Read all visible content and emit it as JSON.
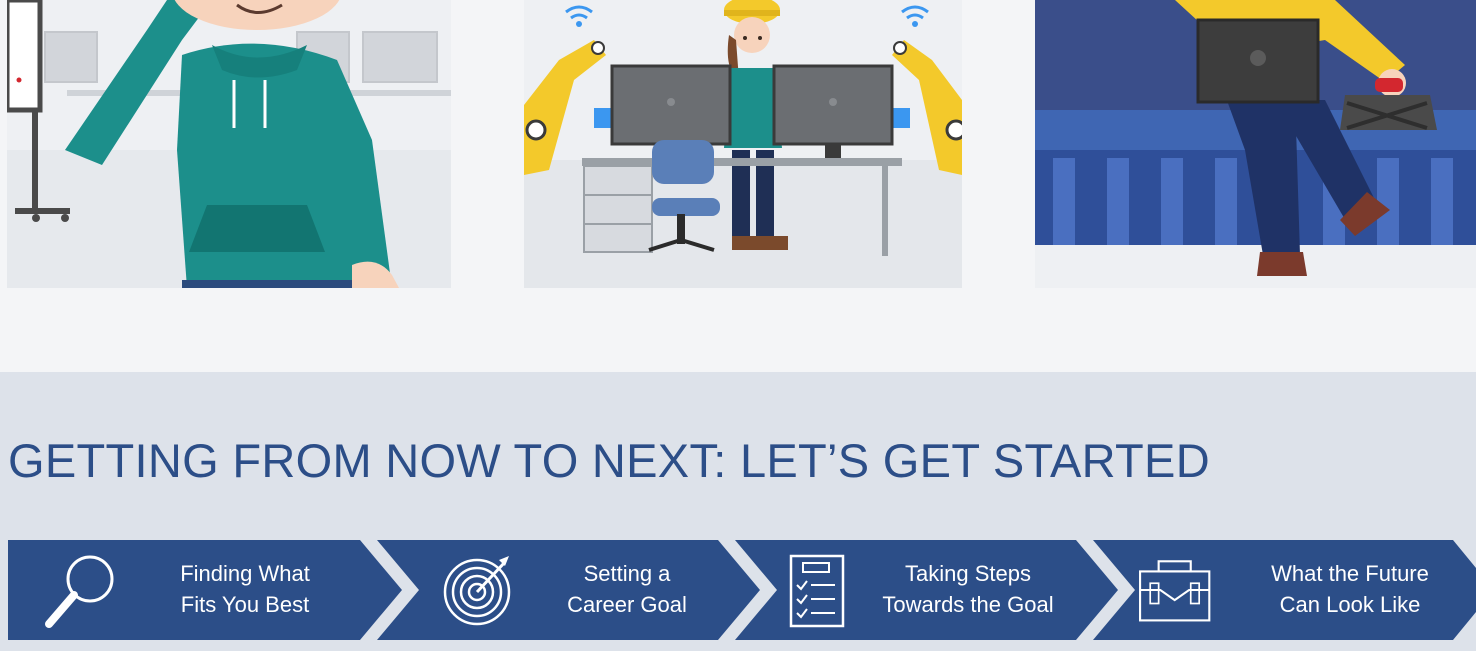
{
  "heading": "GETTING FROM NOW TO NEXT: LET’S GET STARTED",
  "colors": {
    "primary": "#2c4e88",
    "band": "#dde2ea",
    "card_bg": "#eef0f3",
    "teal": "#1c8f8b",
    "yellow": "#f3c92b"
  },
  "images": [
    {
      "name": "student-in-hoodie-illustration"
    },
    {
      "name": "engineer-with-robot-arms-illustration"
    },
    {
      "name": "person-with-laptop-illustration"
    }
  ],
  "steps": [
    {
      "line1": "Finding What",
      "line2": "Fits You Best",
      "icon": "magnifying-glass-icon"
    },
    {
      "line1": "Setting a",
      "line2": "Career Goal",
      "icon": "target-icon"
    },
    {
      "line1": "Taking Steps",
      "line2": "Towards the Goal",
      "icon": "checklist-icon"
    },
    {
      "line1": "What the Future",
      "line2": "Can Look Like",
      "icon": "briefcase-icon"
    }
  ]
}
